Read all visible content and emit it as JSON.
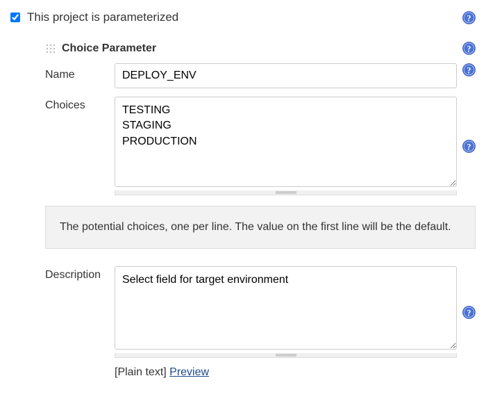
{
  "top": {
    "checkbox_label": "This project is parameterized"
  },
  "param": {
    "heading": "Choice Parameter",
    "name_label": "Name",
    "name_value": "DEPLOY_ENV",
    "choices_label": "Choices",
    "choices_value": "TESTING\nSTAGING\nPRODUCTION",
    "help_text": "The potential choices, one per line. The value on the first line will be the default.",
    "description_label": "Description",
    "description_value": "Select field for target environment",
    "format_label": "[Plain text]",
    "preview_label": "Preview"
  }
}
